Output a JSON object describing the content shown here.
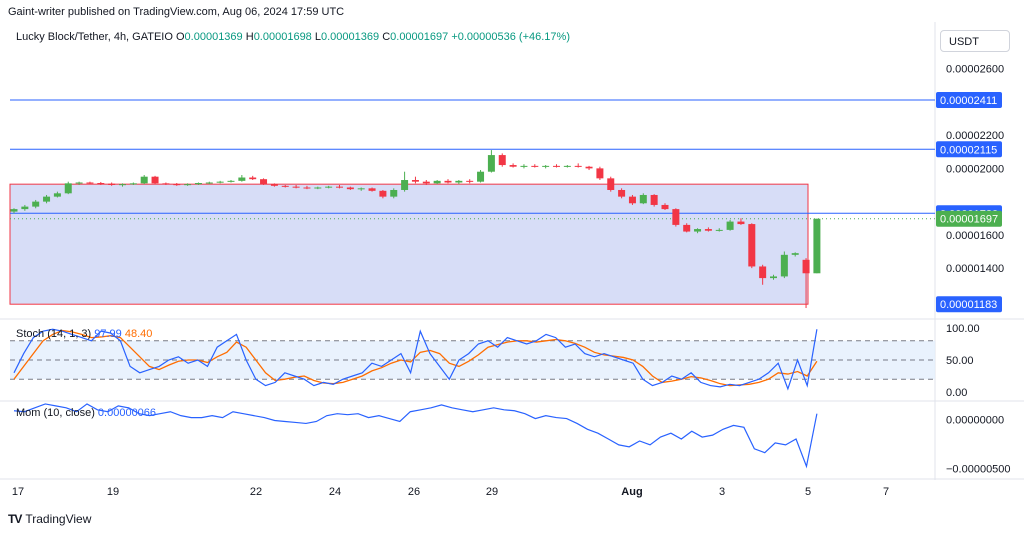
{
  "header": {
    "published": "Gaint-writer published on TradingView.com, Aug 06, 2024 17:59 UTC",
    "title": "Lucky Block/Tether, 4h, GATEIO",
    "open_label": "O",
    "open": "0.00001369",
    "high_label": "H",
    "high": "0.00001698",
    "low_label": "L",
    "low": "0.00001369",
    "close_label": "C",
    "close": "0.00001697",
    "change": "+0.00000536 (+46.17%)"
  },
  "unit_button": "USDT",
  "footer": {
    "logo": "TV",
    "brand": "TradingView"
  },
  "colors": {
    "up": "#4caf50",
    "down": "#f23645",
    "line": "#2962ff",
    "zone": "#b6c1f0",
    "stoch_k": "#2962ff",
    "stoch_d": "#ff6d00",
    "mom": "#2962ff"
  },
  "chart_data": {
    "type": "candlestick",
    "x_ticks": [
      "17",
      "19",
      "22",
      "24",
      "26",
      "29",
      "Aug",
      "3",
      "5",
      "7"
    ],
    "price_ticks": [
      "0.00002600",
      "0.00002200",
      "0.00002000",
      "0.00001600",
      "0.00001400"
    ],
    "price_ylim": [
      1.1e-05,
      2.7e-05
    ],
    "labels": [
      "0.00002411",
      "0.00002115",
      "0.00001730",
      "0.00001697",
      "0.00001183"
    ],
    "horizontal_lines": [
      2.411e-05,
      2.115e-05,
      1.73e-05
    ],
    "last_price": 1.697e-05,
    "support_zone": {
      "from": 1.183e-05,
      "to": 1.905e-05
    },
    "candles": [
      [
        1.74e-05,
        1.76e-05,
        1.73e-05,
        1.755e-05
      ],
      [
        1.755e-05,
        1.78e-05,
        1.745e-05,
        1.77e-05
      ],
      [
        1.77e-05,
        1.81e-05,
        1.76e-05,
        1.8e-05
      ],
      [
        1.8e-05,
        1.84e-05,
        1.79e-05,
        1.83e-05
      ],
      [
        1.83e-05,
        1.86e-05,
        1.825e-05,
        1.85e-05
      ],
      [
        1.85e-05,
        1.92e-05,
        1.845e-05,
        1.91e-05
      ],
      [
        1.91e-05,
        1.92e-05,
        1.9e-05,
        1.915e-05
      ],
      [
        1.915e-05,
        1.92e-05,
        1.905e-05,
        1.912e-05
      ],
      [
        1.912e-05,
        1.918e-05,
        1.9e-05,
        1.908e-05
      ],
      [
        1.908e-05,
        1.915e-05,
        1.895e-05,
        1.9e-05
      ],
      [
        1.9e-05,
        1.91e-05,
        1.89e-05,
        1.905e-05
      ],
      [
        1.905e-05,
        1.915e-05,
        1.9e-05,
        1.91e-05
      ],
      [
        1.91e-05,
        1.96e-05,
        1.905e-05,
        1.95e-05
      ],
      [
        1.95e-05,
        1.955e-05,
        1.905e-05,
        1.91e-05
      ],
      [
        1.91e-05,
        1.915e-05,
        1.9e-05,
        1.905e-05
      ],
      [
        1.905e-05,
        1.912e-05,
        1.895e-05,
        1.9e-05
      ],
      [
        1.9e-05,
        1.91e-05,
        1.895e-05,
        1.905e-05
      ],
      [
        1.905e-05,
        1.915e-05,
        1.9e-05,
        1.912e-05
      ],
      [
        1.912e-05,
        1.92e-05,
        1.905e-05,
        1.915e-05
      ],
      [
        1.915e-05,
        1.925e-05,
        1.91e-05,
        1.92e-05
      ],
      [
        1.92e-05,
        1.93e-05,
        1.915e-05,
        1.925e-05
      ],
      [
        1.925e-05,
        1.96e-05,
        1.92e-05,
        1.945e-05
      ],
      [
        1.945e-05,
        1.955e-05,
        1.93e-05,
        1.935e-05
      ],
      [
        1.935e-05,
        1.94e-05,
        1.9e-05,
        1.905e-05
      ],
      [
        1.905e-05,
        1.91e-05,
        1.89e-05,
        1.895e-05
      ],
      [
        1.895e-05,
        1.9e-05,
        1.885e-05,
        1.89e-05
      ],
      [
        1.89e-05,
        1.9e-05,
        1.88e-05,
        1.885e-05
      ],
      [
        1.885e-05,
        1.895e-05,
        1.875e-05,
        1.88e-05
      ],
      [
        1.88e-05,
        1.89e-05,
        1.875e-05,
        1.885e-05
      ],
      [
        1.885e-05,
        1.895e-05,
        1.88e-05,
        1.89e-05
      ],
      [
        1.89e-05,
        1.9e-05,
        1.88e-05,
        1.885e-05
      ],
      [
        1.885e-05,
        1.89e-05,
        1.87e-05,
        1.875e-05
      ],
      [
        1.875e-05,
        1.885e-05,
        1.865e-05,
        1.88e-05
      ],
      [
        1.88e-05,
        1.885e-05,
        1.86e-05,
        1.865e-05
      ],
      [
        1.865e-05,
        1.87e-05,
        1.82e-05,
        1.83e-05
      ],
      [
        1.83e-05,
        1.88e-05,
        1.82e-05,
        1.87e-05
      ],
      [
        1.87e-05,
        1.98e-05,
        1.86e-05,
        1.93e-05
      ],
      [
        1.93e-05,
        1.95e-05,
        1.91e-05,
        1.92e-05
      ],
      [
        1.92e-05,
        1.93e-05,
        1.9e-05,
        1.91e-05
      ],
      [
        1.91e-05,
        1.93e-05,
        1.905e-05,
        1.925e-05
      ],
      [
        1.925e-05,
        1.935e-05,
        1.91e-05,
        1.915e-05
      ],
      [
        1.915e-05,
        1.93e-05,
        1.905e-05,
        1.925e-05
      ],
      [
        1.925e-05,
        1.935e-05,
        1.91e-05,
        1.92e-05
      ],
      [
        1.92e-05,
        1.99e-05,
        1.915e-05,
        1.98e-05
      ],
      [
        1.98e-05,
        2.11e-05,
        1.975e-05,
        2.08e-05
      ],
      [
        2.08e-05,
        2.09e-05,
        2.01e-05,
        2.02e-05
      ],
      [
        2.02e-05,
        2.03e-05,
        2.005e-05,
        2.01e-05
      ],
      [
        2.01e-05,
        2.025e-05,
        2e-05,
        2.015e-05
      ],
      [
        2.015e-05,
        2.025e-05,
        2.005e-05,
        2.01e-05
      ],
      [
        2.01e-05,
        2.02e-05,
        2e-05,
        2.015e-05
      ],
      [
        2.015e-05,
        2.025e-05,
        2.005e-05,
        2.01e-05
      ],
      [
        2.01e-05,
        2.02e-05,
        2.005e-05,
        2.015e-05
      ],
      [
        2.015e-05,
        2.03e-05,
        2.005e-05,
        2.01e-05
      ],
      [
        2.01e-05,
        2.015e-05,
        1.99e-05,
        2e-05
      ],
      [
        2e-05,
        2.01e-05,
        1.93e-05,
        1.94e-05
      ],
      [
        1.94e-05,
        1.95e-05,
        1.86e-05,
        1.87e-05
      ],
      [
        1.87e-05,
        1.88e-05,
        1.82e-05,
        1.83e-05
      ],
      [
        1.83e-05,
        1.84e-05,
        1.78e-05,
        1.79e-05
      ],
      [
        1.79e-05,
        1.85e-05,
        1.785e-05,
        1.84e-05
      ],
      [
        1.84e-05,
        1.845e-05,
        1.77e-05,
        1.78e-05
      ],
      [
        1.78e-05,
        1.79e-05,
        1.75e-05,
        1.755e-05
      ],
      [
        1.755e-05,
        1.76e-05,
        1.65e-05,
        1.66e-05
      ],
      [
        1.66e-05,
        1.67e-05,
        1.615e-05,
        1.62e-05
      ],
      [
        1.62e-05,
        1.64e-05,
        1.61e-05,
        1.635e-05
      ],
      [
        1.635e-05,
        1.645e-05,
        1.62e-05,
        1.625e-05
      ],
      [
        1.625e-05,
        1.64e-05,
        1.62e-05,
        1.63e-05
      ],
      [
        1.63e-05,
        1.69e-05,
        1.625e-05,
        1.68e-05
      ],
      [
        1.68e-05,
        1.7e-05,
        1.66e-05,
        1.665e-05
      ],
      [
        1.665e-05,
        1.67e-05,
        1.4e-05,
        1.41e-05
      ],
      [
        1.41e-05,
        1.42e-05,
        1.3e-05,
        1.34e-05
      ],
      [
        1.34e-05,
        1.36e-05,
        1.33e-05,
        1.35e-05
      ],
      [
        1.35e-05,
        1.5e-05,
        1.34e-05,
        1.48e-05
      ],
      [
        1.48e-05,
        1.495e-05,
        1.47e-05,
        1.49e-05
      ],
      [
        1.45e-05,
        1.46e-05,
        1.16e-05,
        1.369e-05
      ],
      [
        1.369e-05,
        1.698e-05,
        1.369e-05,
        1.697e-05
      ]
    ],
    "stoch": {
      "label": "Stoch",
      "params": "(14, 1, 3)",
      "k_value": "97.99",
      "d_value": "48.40",
      "ticks": [
        "100.00",
        "50.00",
        "0.00"
      ],
      "bands": [
        80,
        50,
        20
      ],
      "k": [
        30,
        60,
        85,
        95,
        98,
        95,
        90,
        85,
        80,
        95,
        92,
        80,
        40,
        30,
        35,
        40,
        50,
        55,
        45,
        50,
        40,
        70,
        80,
        90,
        50,
        20,
        10,
        15,
        30,
        25,
        20,
        10,
        15,
        12,
        20,
        25,
        30,
        45,
        40,
        50,
        60,
        30,
        95,
        60,
        40,
        20,
        50,
        60,
        75,
        80,
        70,
        85,
        80,
        75,
        80,
        90,
        85,
        70,
        75,
        60,
        55,
        60,
        55,
        50,
        45,
        20,
        10,
        15,
        25,
        20,
        30,
        15,
        10,
        8,
        12,
        10,
        15,
        20,
        30,
        45,
        5,
        50,
        10,
        98
      ],
      "d": [
        20,
        40,
        60,
        80,
        90,
        96,
        94,
        90,
        85,
        86,
        88,
        85,
        70,
        55,
        40,
        35,
        42,
        48,
        50,
        50,
        46,
        55,
        62,
        78,
        70,
        50,
        30,
        18,
        20,
        23,
        25,
        18,
        14,
        13,
        15,
        20,
        25,
        33,
        38,
        45,
        50,
        47,
        62,
        65,
        60,
        45,
        40,
        48,
        58,
        70,
        74,
        78,
        80,
        80,
        78,
        80,
        82,
        80,
        76,
        70,
        62,
        58,
        56,
        54,
        50,
        40,
        25,
        15,
        17,
        20,
        24,
        22,
        18,
        13,
        10,
        11,
        12,
        15,
        20,
        30,
        28,
        32,
        25,
        48
      ]
    },
    "momentum": {
      "label": "Mom",
      "params": "(10, close)",
      "value": "0.00000066",
      "ticks": [
        "0.00000000",
        "−0.00000500"
      ],
      "ylim": [
        -6e-06,
        1.8e-06
      ],
      "values": [
        9e-07,
        8e-07,
        1.2e-06,
        1.6e-06,
        1.4e-06,
        1.2e-06,
        8e-07,
        1.6e-06,
        1e-06,
        8e-07,
        1.4e-06,
        1.2e-06,
        6e-07,
        4e-07,
        6e-07,
        8e-07,
        4e-07,
        2e-07,
        2e-07,
        4e-07,
        2e-07,
        8e-07,
        6e-07,
        4e-07,
        2e-07,
        -1e-07,
        -2e-07,
        -3e-07,
        -4e-07,
        -2e-07,
        4e-07,
        6e-07,
        5e-07,
        6e-07,
        2e-07,
        4e-07,
        1e-07,
        -2e-07,
        8e-07,
        1e-06,
        1.2e-06,
        1.5e-06,
        1.2e-06,
        1e-06,
        8e-07,
        1e-06,
        1.2e-06,
        1e-06,
        9e-07,
        6e-07,
        1e-07,
        4e-07,
        2e-07,
        1e-07,
        -4e-07,
        -1e-06,
        -1.4e-06,
        -2e-06,
        -2.6e-06,
        -2.8e-06,
        -2.2e-06,
        -2.6e-06,
        -1.8e-06,
        -1.4e-06,
        -2e-06,
        -1.2e-06,
        -1.8e-06,
        -1.6e-06,
        -1e-06,
        -6e-07,
        -8e-07,
        -3e-06,
        -3.4e-06,
        -2.4e-06,
        -2.6e-06,
        -2e-06,
        -4.8e-06,
        6e-07
      ]
    }
  }
}
